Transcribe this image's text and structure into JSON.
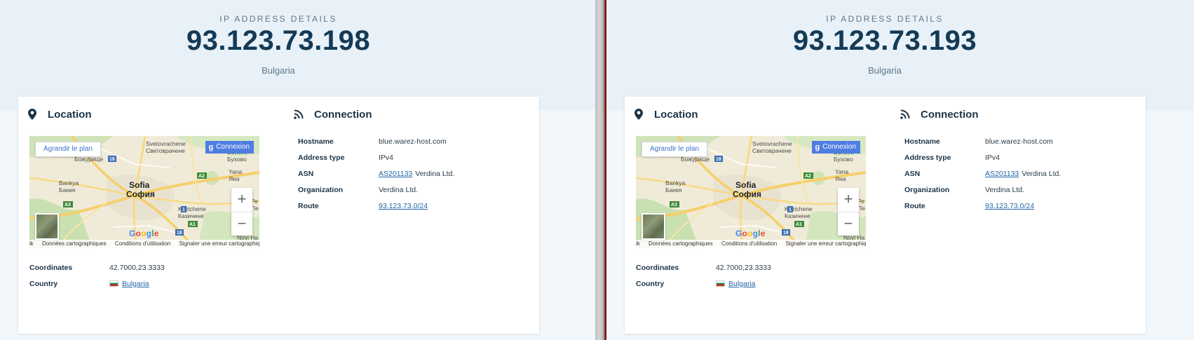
{
  "panels": [
    {
      "header": {
        "subtitle": "IP ADDRESS DETAILS",
        "ip": "93.123.73.198",
        "country": "Bulgaria"
      },
      "location": {
        "title": "Location",
        "map": {
          "enlarge_label": "Agrandir le plan",
          "login_label": "Connexion",
          "login_icon": "g",
          "zoom_in": "+",
          "zoom_out": "−",
          "google_logo": "Google",
          "place_labels": [
            "Svetovrachene",
            "Световрачене",
            "Божурище",
            "Bankya",
            "Банкя",
            "Sofia",
            "София",
            "Kazichene",
            "Казичене",
            "Buhovo",
            "Бухово",
            "Yana",
            "Яна",
            "Novi Ha",
            "Ре",
            "Пе"
          ],
          "road_labels": [
            "18",
            "A2",
            "A3",
            "1",
            "A1",
            "18"
          ],
          "footer": [
            "Données cartographiques",
            "Conditions d'utilisation",
            "Signaler une erreur cartographique"
          ],
          "footer_prefix": "ik"
        },
        "coordinates_label": "Coordinates",
        "coordinates_value": "42.7000,23.3333",
        "country_label": "Country",
        "country_value": "Bulgaria"
      },
      "connection": {
        "title": "Connection",
        "rows": [
          {
            "label": "Hostname",
            "value": "blue.warez-host.com"
          },
          {
            "label": "Address type",
            "value": "IPv4"
          },
          {
            "label": "ASN",
            "link": "AS201133",
            "value": "Verdina Ltd."
          },
          {
            "label": "Organization",
            "value": "Verdina Ltd."
          },
          {
            "label": "Route",
            "link": "93.123.73.0/24"
          }
        ]
      }
    },
    {
      "header": {
        "subtitle": "IP ADDRESS DETAILS",
        "ip": "93.123.73.193",
        "country": "Bulgaria"
      },
      "location": {
        "title": "Location",
        "map": {
          "enlarge_label": "Agrandir le plan",
          "login_label": "Connexion",
          "login_icon": "g",
          "zoom_in": "+",
          "zoom_out": "−",
          "google_logo": "Google",
          "place_labels": [
            "Svetovrachene",
            "Световрачене",
            "Божурище",
            "Bankya",
            "Банкя",
            "Sofia",
            "София",
            "Kazichene",
            "Казичене",
            "Buhovo",
            "Бухово",
            "Yana",
            "Яна",
            "Novi Ha",
            "Ре",
            "Пе"
          ],
          "road_labels": [
            "18",
            "A2",
            "A3",
            "1",
            "A1",
            "18"
          ],
          "footer": [
            "Données cartographiques",
            "Conditions d'utilisation",
            "Signaler une erreur cartographique"
          ],
          "footer_prefix": "ik"
        },
        "coordinates_label": "Coordinates",
        "coordinates_value": "42.7000,23.3333",
        "country_label": "Country",
        "country_value": "Bulgaria"
      },
      "connection": {
        "title": "Connection",
        "rows": [
          {
            "label": "Hostname",
            "value": "blue.warez-host.com"
          },
          {
            "label": "Address type",
            "value": "IPv4"
          },
          {
            "label": "ASN",
            "link": "AS201133",
            "value": "Verdina Ltd."
          },
          {
            "label": "Organization",
            "value": "Verdina Ltd."
          },
          {
            "label": "Route",
            "link": "93.123.73.0/24"
          }
        ]
      }
    }
  ],
  "colors": {
    "accent": "#143a56",
    "link": "#2466a7",
    "map_land": "#f0ebd8",
    "map_road": "#f6cf6a"
  },
  "icons": {
    "location": "map-pin-icon",
    "connection": "wifi-signal-icon"
  }
}
